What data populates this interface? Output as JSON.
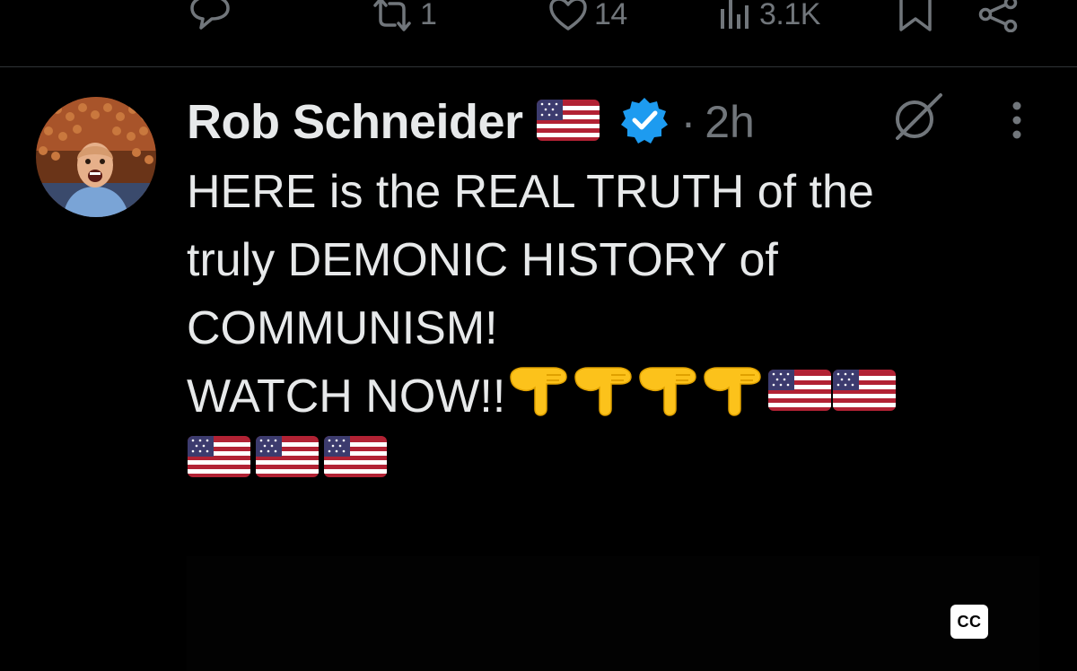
{
  "action_bar": {
    "reply_icon": "speech-bubble-icon",
    "repost_count": "1",
    "like_count": "14",
    "views_count": "3.1K",
    "bookmark_icon": "bookmark-icon",
    "share_icon": "share-icon"
  },
  "post": {
    "author_name": "Rob Schneider",
    "verified_badge": "verified-badge-icon",
    "timestamp_separator": "·",
    "timestamp": "2h",
    "body_lines": [
      "HERE is the REAL TRUTH of the",
      "truly DEMONIC HISTORY of",
      "COMMUNISM!",
      "WATCH NOW!!"
    ],
    "emoji": {
      "pointing_hand": "backhand-index-pointing-down",
      "flag": "flag-united-states"
    },
    "emoji_counts": {
      "hands_after_watch": 4,
      "flags_after_watch": 2,
      "flags_next_line": 3
    }
  },
  "media": {
    "cc_label": "CC"
  },
  "colors": {
    "background": "#000000",
    "text_primary": "#e7e9ea",
    "text_secondary": "#71767b",
    "verified_blue": "#1d9bf0",
    "divider": "#2f3336"
  }
}
